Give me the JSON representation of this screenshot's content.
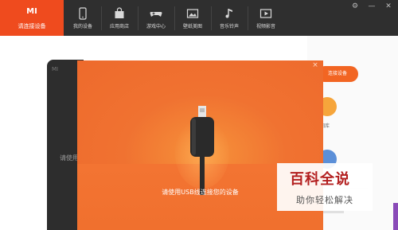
{
  "brand": {
    "logo": "MI",
    "label": "请连接设备",
    "color": "#ef4b1e"
  },
  "nav": [
    {
      "label": "我的设备",
      "icon": "phone-icon"
    },
    {
      "label": "应用商店",
      "icon": "bag-icon"
    },
    {
      "label": "游戏中心",
      "icon": "gamepad-icon"
    },
    {
      "label": "壁纸美图",
      "icon": "picture-icon"
    },
    {
      "label": "音乐铃声",
      "icon": "music-note-icon"
    },
    {
      "label": "视频影音",
      "icon": "video-icon"
    }
  ],
  "window": {
    "settings": "⚙",
    "minimize": "—",
    "close": "✕"
  },
  "background": {
    "phone_logo": "MI",
    "phone_hint": "请使用",
    "connect_button": "连接设备",
    "gallery_label": "图库"
  },
  "dialog": {
    "close": "×",
    "message": "请使用USB线连接您的设备",
    "accent": "#f07231"
  },
  "watermark": {
    "title": "百科全说",
    "subtitle": "助你轻松解决"
  }
}
